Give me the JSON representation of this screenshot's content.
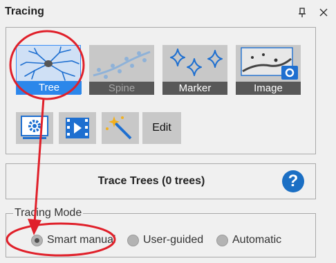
{
  "window": {
    "title": "Tracing"
  },
  "tiles": [
    {
      "label": "Tree",
      "state": "selected"
    },
    {
      "label": "Spine",
      "state": "disabled"
    },
    {
      "label": "Marker",
      "state": "normal"
    },
    {
      "label": "Image",
      "state": "normal"
    }
  ],
  "toolbar": {
    "edit_label": "Edit"
  },
  "trace": {
    "label": "Trace Trees (0 trees)",
    "help_glyph": "?"
  },
  "mode": {
    "legend": "Tracing Mode",
    "options": [
      {
        "label": "Smart manual",
        "selected": true
      },
      {
        "label": "User-guided",
        "selected": false
      },
      {
        "label": "Automatic",
        "selected": false
      }
    ]
  },
  "colors": {
    "accent": "#2b87ea",
    "annotation": "#e0202a",
    "help": "#1b6fc4"
  }
}
